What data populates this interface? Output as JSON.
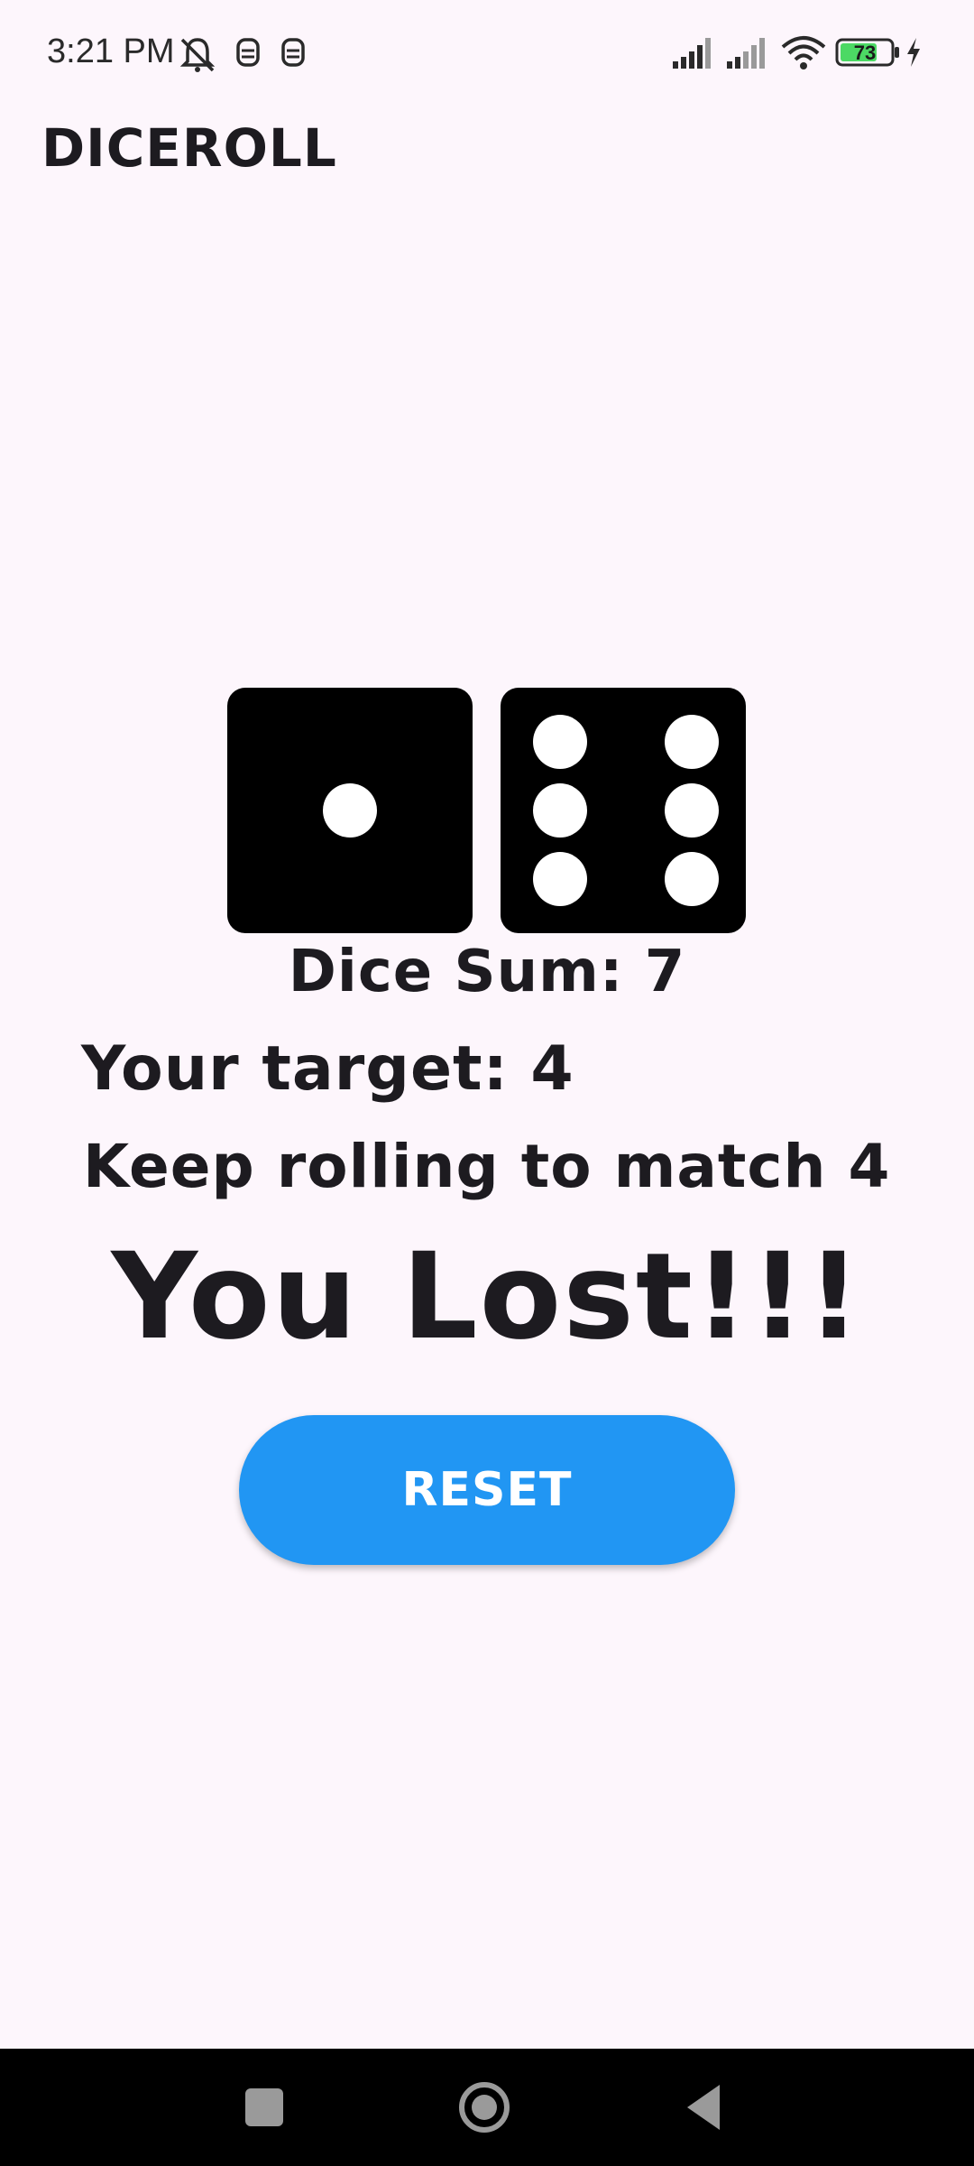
{
  "status_bar": {
    "time": "3:21 PM",
    "battery_level": "73",
    "icons": [
      "mute-icon",
      "notification-icon",
      "notification-icon",
      "signal-icon",
      "signal-icon",
      "wifi-icon",
      "battery-icon",
      "charging-icon"
    ]
  },
  "app_bar": {
    "title": "DICEROLL"
  },
  "dice": {
    "left_value": 1,
    "right_value": 6
  },
  "game": {
    "dice_sum": "Dice Sum: 7",
    "target": "Your target: 4",
    "hint": "Keep rolling to match 4",
    "result": "You Lost!!!"
  },
  "actions": {
    "reset_label": "RESET"
  },
  "colors": {
    "background": "#FDF6FC",
    "accent": "#2196F3",
    "text": "#1D1B20",
    "battery_fill": "#4CD964"
  },
  "nav_bar": {
    "icons": [
      "recents-icon",
      "home-icon",
      "back-icon"
    ]
  }
}
